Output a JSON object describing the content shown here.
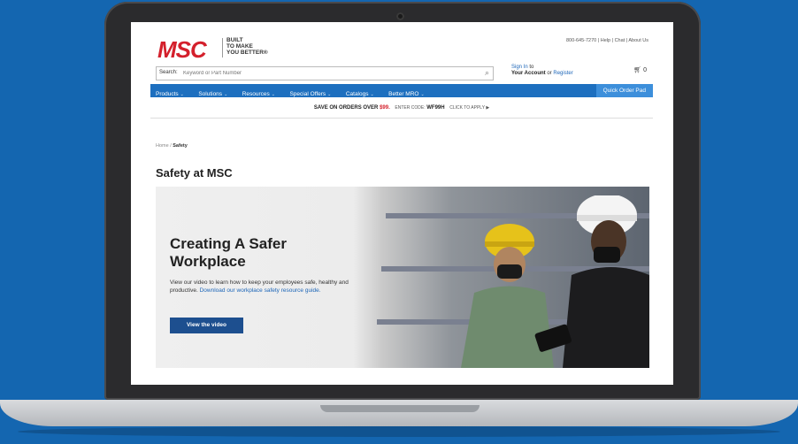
{
  "header": {
    "logo": "MSC",
    "tagline": [
      "BUILT",
      "TO MAKE",
      "YOU BETTER®"
    ],
    "phone": "800-645-7270",
    "help": "Help",
    "chat": "Chat",
    "about": "About Us"
  },
  "search": {
    "label": "Search:",
    "placeholder": "Keyword or Part Number"
  },
  "account": {
    "sign_in": "Sign In",
    "to": "to",
    "your_account": "Your Account",
    "or": "or",
    "register": "Register",
    "cart_count": "0"
  },
  "nav": {
    "items": [
      "Products",
      "Solutions",
      "Resources",
      "Special Offers",
      "Catalogs",
      "Better MRO"
    ],
    "quick_order": "Quick Order Pad"
  },
  "promo": {
    "text": "SAVE ON ORDERS OVER",
    "amount": "$99.",
    "code_label": "ENTER CODE:",
    "code": "WF99H",
    "cta": "CLICK TO APPLY ▶"
  },
  "breadcrumb": {
    "home": "Home",
    "sep": "/",
    "current": "Safety"
  },
  "page": {
    "title": "Safety at MSC"
  },
  "hero": {
    "title": "Creating A Safer Workplace",
    "text": "View our video to learn how to keep your employees safe, healthy and productive.",
    "link": "Download our workplace safety resource guide.",
    "button": "View the video"
  },
  "colors": {
    "brand_red": "#d4202c",
    "nav_blue": "#1d6fbf",
    "background_blue": "#1466b0"
  }
}
